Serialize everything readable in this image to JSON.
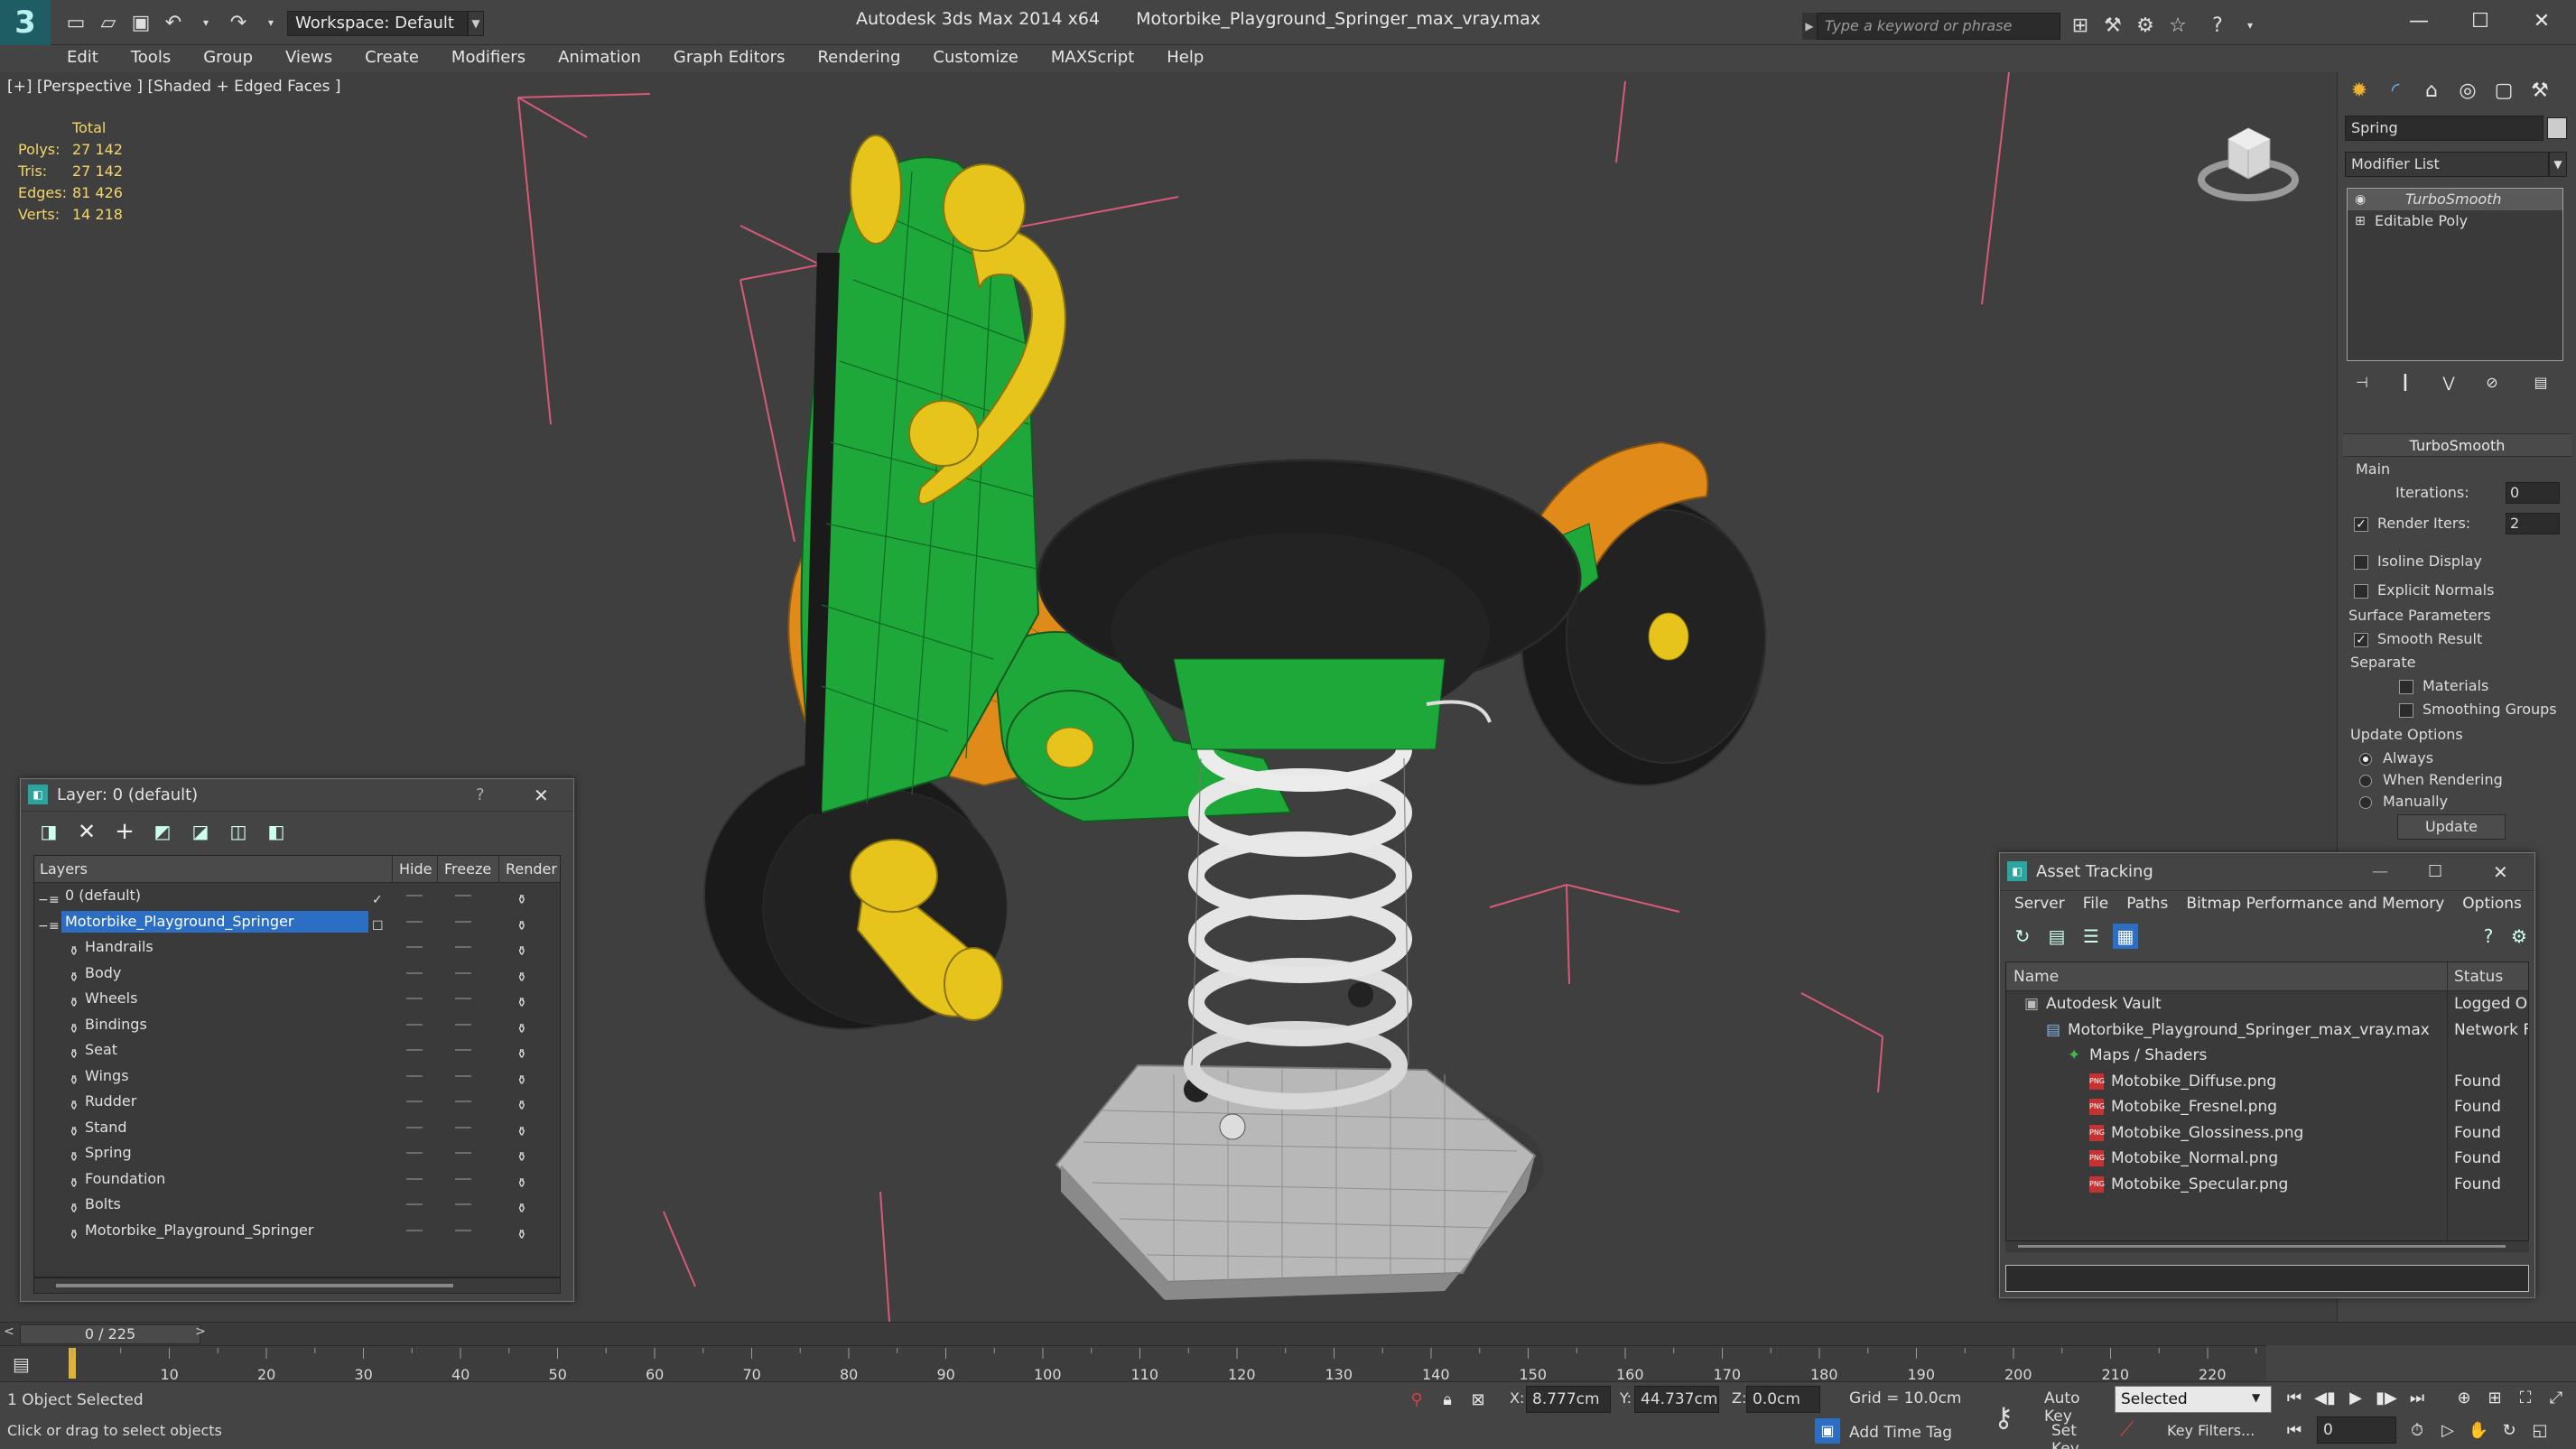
{
  "titlebar": {
    "workspace": "Workspace: Default",
    "app_name": "Autodesk 3ds Max  2014 x64",
    "file_name": "Motorbike_Playground_Springer_max_vray.max",
    "search_placeholder": "Type a keyword or phrase"
  },
  "menu": [
    "Edit",
    "Tools",
    "Group",
    "Views",
    "Create",
    "Modifiers",
    "Animation",
    "Graph Editors",
    "Rendering",
    "Customize",
    "MAXScript",
    "Help"
  ],
  "viewport": {
    "label": "[+] [Perspective ] [Shaded + Edged Faces ]",
    "stats": {
      "header": "Total",
      "rows": [
        {
          "label": "Polys:",
          "value": "27 142"
        },
        {
          "label": "Tris:",
          "value": "27 142"
        },
        {
          "label": "Edges:",
          "value": "81 426"
        },
        {
          "label": "Verts:",
          "value": "14 218"
        }
      ]
    }
  },
  "command_panel": {
    "object_name": "Spring",
    "modifier_list": "Modifier List",
    "stack": [
      "TurboSmooth",
      "Editable Poly"
    ],
    "rollout_title": "TurboSmooth",
    "main_group": "Main",
    "iterations_label": "Iterations:",
    "iterations_value": "0",
    "render_iters_label": "Render Iters:",
    "render_iters_value": "2",
    "isoline_display": "Isoline Display",
    "explicit_normals": "Explicit Normals",
    "surface_params": "Surface Parameters",
    "smooth_result": "Smooth Result",
    "separate": "Separate",
    "materials": "Materials",
    "smoothing_groups": "Smoothing Groups",
    "update_options": "Update Options",
    "always": "Always",
    "when_rendering": "When Rendering",
    "manually": "Manually",
    "update_btn": "Update"
  },
  "layer_dialog": {
    "title": "Layer: 0 (default)",
    "help": "?",
    "columns": [
      "Layers",
      "Hide",
      "Freeze",
      "Render"
    ],
    "rows": [
      {
        "name": "0 (default)",
        "indent": 0,
        "selected": false
      },
      {
        "name": "Motorbike_Playground_Springer",
        "indent": 0,
        "selected": true
      },
      {
        "name": "Handrails",
        "indent": 1,
        "selected": false
      },
      {
        "name": "Body",
        "indent": 1,
        "selected": false
      },
      {
        "name": "Wheels",
        "indent": 1,
        "selected": false
      },
      {
        "name": "Bindings",
        "indent": 1,
        "selected": false
      },
      {
        "name": "Seat",
        "indent": 1,
        "selected": false
      },
      {
        "name": "Wings",
        "indent": 1,
        "selected": false
      },
      {
        "name": "Rudder",
        "indent": 1,
        "selected": false
      },
      {
        "name": "Stand",
        "indent": 1,
        "selected": false
      },
      {
        "name": "Spring",
        "indent": 1,
        "selected": false
      },
      {
        "name": "Foundation",
        "indent": 1,
        "selected": false
      },
      {
        "name": "Bolts",
        "indent": 1,
        "selected": false
      },
      {
        "name": "Motorbike_Playground_Springer",
        "indent": 1,
        "selected": false
      }
    ]
  },
  "asset_dialog": {
    "title": "Asset Tracking",
    "menu": [
      "Server",
      "File",
      "Paths",
      "Bitmap Performance and Memory",
      "Options"
    ],
    "columns": [
      "Name",
      "Status"
    ],
    "rows": [
      {
        "name": "Autodesk Vault",
        "status": "Logged O",
        "indent": 0
      },
      {
        "name": "Motorbike_Playground_Springer_max_vray.max",
        "status": "Network F",
        "indent": 1
      },
      {
        "name": "Maps / Shaders",
        "status": "",
        "indent": 2
      },
      {
        "name": "Motobike_Diffuse.png",
        "status": "Found",
        "indent": 3
      },
      {
        "name": "Motobike_Fresnel.png",
        "status": "Found",
        "indent": 3
      },
      {
        "name": "Motobike_Glossiness.png",
        "status": "Found",
        "indent": 3
      },
      {
        "name": "Motobike_Normal.png",
        "status": "Found",
        "indent": 3
      },
      {
        "name": "Motobike_Specular.png",
        "status": "Found",
        "indent": 3
      }
    ]
  },
  "timeline": {
    "frame": "0 / 225",
    "ticks": [
      "10",
      "20",
      "30",
      "40",
      "50",
      "60",
      "70",
      "80",
      "90",
      "100",
      "110",
      "120",
      "130",
      "140",
      "150",
      "160",
      "170",
      "180",
      "190",
      "200",
      "210",
      "220"
    ]
  },
  "status": {
    "selection": "1 Object Selected",
    "prompt": "Click or drag to select objects",
    "x_label": "X:",
    "x_value": "8.777cm",
    "y_label": "Y:",
    "y_value": "44.737cm",
    "z_label": "Z:",
    "z_value": "0.0cm",
    "grid": "Grid = 10.0cm",
    "add_time_tag": "Add Time Tag",
    "auto_key": "Auto Key",
    "set_key": "Set Key",
    "selected_dropdown": "Selected",
    "key_filters": "Key Filters...",
    "current_frame": "0"
  },
  "colors": {
    "stats_yellow": "#f5d66a",
    "selection_blue": "#2c6ec4",
    "grid_pink": "#d85a7a",
    "body_green": "#1fa83a",
    "body_orange": "#e08a1a",
    "bolt_yellow": "#e6c41c"
  }
}
